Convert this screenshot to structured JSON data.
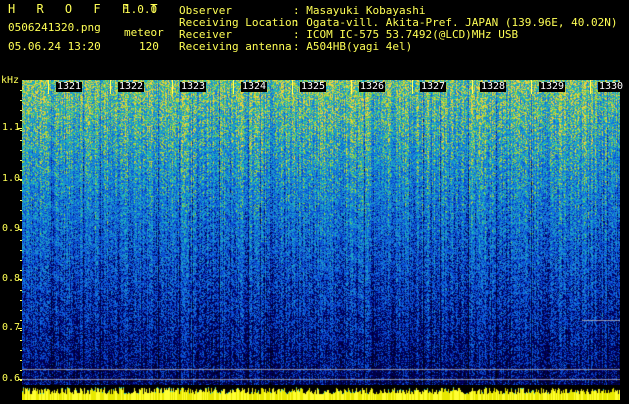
{
  "app": {
    "title": "H R O F F T",
    "version": "1.0.0"
  },
  "file": {
    "name": "0506241320.png",
    "timestamp": "05.06.24 13:20"
  },
  "meteor": {
    "label": "meteor",
    "count": "120"
  },
  "info": {
    "observer_label": "Observer",
    "observer_value": ": Masayuki Kobayashi",
    "location_label": "Receiving Location",
    "location_value": ": Ogata-vill. Akita-Pref. JAPAN (139.96E, 40.02N)",
    "receiver_label": "Receiver",
    "receiver_value": ": ICOM IC-575 53.7492(@LCD)MHz USB",
    "antenna_label": "Receiving antenna",
    "antenna_value": ": A504HB(yagi 4el)"
  },
  "spectrogram": {
    "y_unit": "kHz",
    "y_ticks": [
      "1.1",
      "1.0",
      "0.9",
      "0.8",
      "0.7",
      "0.6"
    ],
    "minute_labels": [
      "1321",
      "1322",
      "1323",
      "1324",
      "1325",
      "1326",
      "1327",
      "1328",
      "1329",
      "1330"
    ],
    "colors": {
      "low": "#00006e",
      "mid": "#1e64dc",
      "high": "#28c8b4",
      "peak": "#dcdc28",
      "axis": "#ffff55"
    }
  }
}
